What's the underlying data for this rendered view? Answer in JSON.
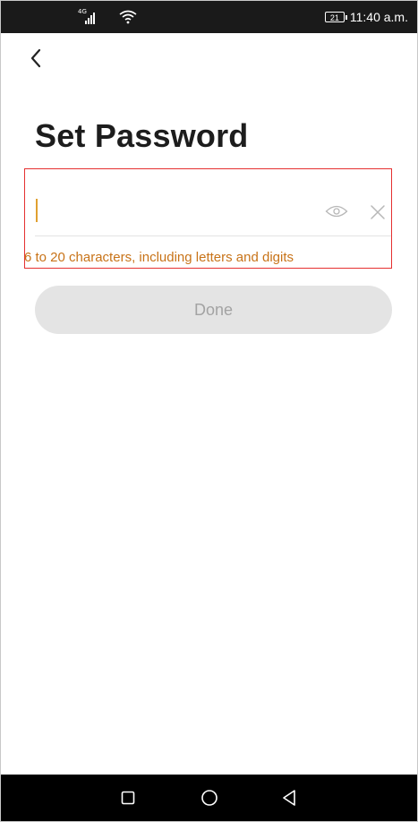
{
  "status_bar": {
    "network_type": "4G",
    "battery_level": "21",
    "time": "11:40 a.m."
  },
  "header": {
    "back_icon": "chevron-left-icon"
  },
  "main": {
    "title": "Set Password",
    "password": {
      "value": "",
      "visibility_icon": "eye-icon",
      "clear_icon": "close-icon"
    },
    "hint": "6 to 20 characters, including letters and digits",
    "done_label": "Done"
  },
  "nav_bar": {
    "buttons": [
      "recents-square-icon",
      "home-circle-icon",
      "back-triangle-icon"
    ]
  },
  "colors": {
    "hint": "#c87318",
    "caret": "#e0a030",
    "highlight_border": "#e53030",
    "done_bg": "#e4e4e4",
    "done_text": "#a3a3a3",
    "status_bg": "#1a1a1a",
    "nav_bg": "#000000"
  }
}
